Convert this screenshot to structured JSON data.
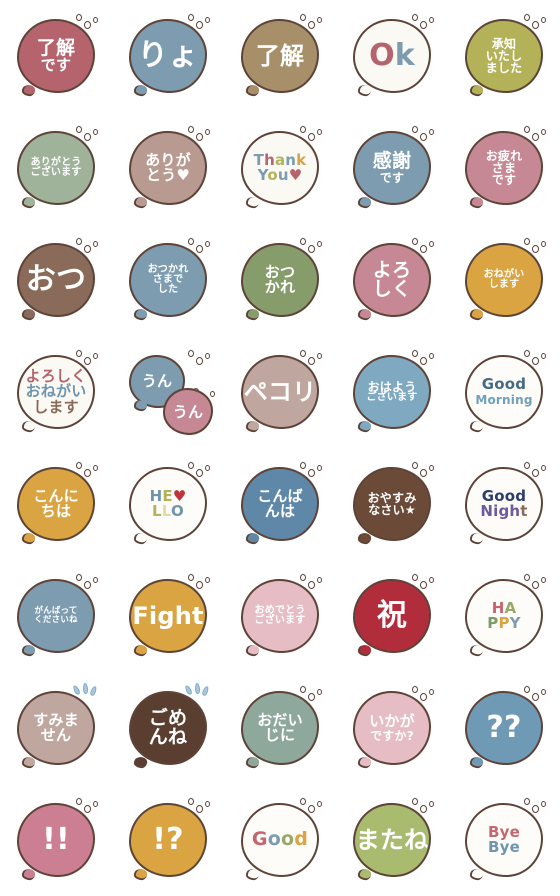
{
  "sheet": {
    "title": "Japanese Greeting Speech-Bubble Emoji Sheet",
    "background": "#ffffff",
    "columns": 5,
    "rows": 8,
    "outline_color": "#5d4338",
    "deco_bubble_color": "#ffffff",
    "sweat_drop_color": "#a8c9dd"
  },
  "stickers": [
    {
      "id": "r1c1",
      "name": "ryoukai-desu",
      "bubble_color": "#b5636c",
      "text_color": "#ffffff",
      "deco": "bubbles",
      "lines": [
        {
          "text": "了解",
          "size": "s-lg"
        },
        {
          "text": "です",
          "size": "s-md"
        }
      ]
    },
    {
      "id": "r1c2",
      "name": "ryo",
      "bubble_color": "#7d9cb0",
      "text_color": "#ffffff",
      "deco": "bubbles",
      "lines": [
        {
          "text": "りょ",
          "size": "s-xxl"
        }
      ]
    },
    {
      "id": "r1c3",
      "name": "ryoukai",
      "bubble_color": "#a78f6a",
      "text_color": "#ffffff",
      "deco": "bubbles",
      "lines": [
        {
          "text": "了解",
          "size": "s-xl"
        }
      ]
    },
    {
      "id": "r1c4",
      "name": "ok",
      "bubble_color": "#fbf9f4",
      "text_color": "#b5636c",
      "deco": "bubbles",
      "rich": [
        {
          "text": "O",
          "color": "#b5636c",
          "size": "s-xxl"
        },
        {
          "text": "k",
          "color": "#7d9cb0",
          "size": "s-xxl"
        }
      ]
    },
    {
      "id": "r1c5",
      "name": "shouchi-itashimashita",
      "bubble_color": "#b3b259",
      "text_color": "#ffffff",
      "deco": "bubbles",
      "lines": [
        {
          "text": "承知",
          "size": "s-sm"
        },
        {
          "text": "いたし",
          "size": "s-sm"
        },
        {
          "text": "ました",
          "size": "s-sm"
        }
      ]
    },
    {
      "id": "r2c1",
      "name": "arigatou-gozaimasu",
      "bubble_color": "#9fb39a",
      "text_color": "#ffffff",
      "deco": "bubbles",
      "lines": [
        {
          "text": "ありがとう",
          "size": "s-xs"
        },
        {
          "text": "ございます",
          "size": "s-xs"
        }
      ]
    },
    {
      "id": "r2c2",
      "name": "arigatou",
      "bubble_color": "#b99a90",
      "text_color": "#ffffff",
      "deco": "bubbles",
      "lines": [
        {
          "text": "ありが",
          "size": "s-md"
        },
        {
          "text": "とう♥",
          "size": "s-md"
        }
      ]
    },
    {
      "id": "r2c3",
      "name": "thank-you",
      "bubble_color": "#fbf9f4",
      "text_color": "#7d9cb0",
      "deco": "bubbles",
      "rich_lines": [
        [
          {
            "text": "T",
            "color": "#7d9cb0"
          },
          {
            "text": "h",
            "color": "#b5636c"
          },
          {
            "text": "a",
            "color": "#b3b259"
          },
          {
            "text": "n",
            "color": "#7d9cb0"
          },
          {
            "text": "k",
            "color": "#d9a441"
          }
        ],
        [
          {
            "text": "Y",
            "color": "#7d9cb0"
          },
          {
            "text": "o",
            "color": "#b3b259"
          },
          {
            "text": "u",
            "color": "#7d9cb0"
          },
          {
            "text": "♥",
            "color": "#b5636c"
          }
        ]
      ]
    },
    {
      "id": "r2c4",
      "name": "kansha-desu",
      "bubble_color": "#7d9cb0",
      "text_color": "#ffffff",
      "deco": "bubbles",
      "lines": [
        {
          "text": "感謝",
          "size": "s-lg"
        },
        {
          "text": "です",
          "size": "s-sm"
        }
      ]
    },
    {
      "id": "r2c5",
      "name": "otsukaresama-desu",
      "bubble_color": "#c68894",
      "text_color": "#ffffff",
      "deco": "bubbles",
      "lines": [
        {
          "text": "お疲れ",
          "size": "s-sm"
        },
        {
          "text": "さま",
          "size": "s-sm"
        },
        {
          "text": "です",
          "size": "s-sm"
        }
      ]
    },
    {
      "id": "r3c1",
      "name": "otsu",
      "bubble_color": "#8a6a58",
      "text_color": "#ffffff",
      "deco": "bubbles",
      "lines": [
        {
          "text": "おつ",
          "size": "s-xxl"
        }
      ]
    },
    {
      "id": "r3c2",
      "name": "otsukaresama-deshita",
      "bubble_color": "#7d9cb0",
      "text_color": "#ffffff",
      "deco": "bubbles",
      "lines": [
        {
          "text": "おつかれ",
          "size": "s-xs"
        },
        {
          "text": "さまで",
          "size": "s-xs"
        },
        {
          "text": "した",
          "size": "s-xs"
        }
      ]
    },
    {
      "id": "r3c3",
      "name": "otsukare",
      "bubble_color": "#879c6b",
      "text_color": "#ffffff",
      "deco": "bubbles",
      "lines": [
        {
          "text": "おつ",
          "size": "s-md"
        },
        {
          "text": "かれ",
          "size": "s-md"
        }
      ]
    },
    {
      "id": "r3c4",
      "name": "yoroshiku",
      "bubble_color": "#c68894",
      "text_color": "#ffffff",
      "deco": "bubbles",
      "lines": [
        {
          "text": "よろ",
          "size": "s-lg"
        },
        {
          "text": "しく",
          "size": "s-lg"
        }
      ]
    },
    {
      "id": "r3c5",
      "name": "onegai-shimasu",
      "bubble_color": "#d9a441",
      "text_color": "#ffffff",
      "deco": "bubbles",
      "lines": [
        {
          "text": "おねがい",
          "size": "s-xs"
        },
        {
          "text": "します",
          "size": "s-xs"
        }
      ]
    },
    {
      "id": "r4c1",
      "name": "yoroshiku-onegai-shimasu",
      "bubble_color": "#fbf9f4",
      "text_color": "#b5636c",
      "deco": "bubbles",
      "rich_lines": [
        [
          {
            "text": "よろしく",
            "color": "#b5636c"
          }
        ],
        [
          {
            "text": "おねがい",
            "color": "#6f95ae"
          }
        ],
        [
          {
            "text": "します",
            "color": "#8a6a58"
          }
        ]
      ]
    },
    {
      "id": "r4c2",
      "name": "un-un-double",
      "bubble_color": "#7d9cb0",
      "text_color": "#ffffff",
      "bubble2_color": "#c68894",
      "deco": "bubbles-double",
      "lines": [
        {
          "text": "うん",
          "size": "s-md"
        }
      ],
      "lines2": [
        {
          "text": "うん",
          "size": "s-md"
        }
      ]
    },
    {
      "id": "r4c3",
      "name": "pekori",
      "bubble_color": "#bfa69f",
      "text_color": "#ffffff",
      "deco": "bubbles",
      "lines": [
        {
          "text": "ペコリ",
          "size": "s-xl"
        }
      ]
    },
    {
      "id": "r4c4",
      "name": "ohayou-gozaimasu",
      "bubble_color": "#7ea9c0",
      "text_color": "#ffffff",
      "deco": "bubbles",
      "lines": [
        {
          "text": "おはよう",
          "size": "s-sm"
        },
        {
          "text": "ございます",
          "size": "s-xs"
        }
      ]
    },
    {
      "id": "r4c5",
      "name": "good-morning",
      "bubble_color": "#fdfcf8",
      "text_color": "#4a6d85",
      "deco": "bubbles",
      "rich_lines": [
        [
          {
            "text": "Good",
            "color": "#456b84",
            "size": "s-md"
          }
        ],
        [
          {
            "text": "Morning",
            "color": "#6fa0bd",
            "size": "s-sm"
          }
        ]
      ]
    },
    {
      "id": "r5c1",
      "name": "konnichiwa",
      "bubble_color": "#d9a441",
      "text_color": "#ffffff",
      "deco": "bubbles",
      "lines": [
        {
          "text": "こんに",
          "size": "s-md"
        },
        {
          "text": "ちは",
          "size": "s-md"
        }
      ]
    },
    {
      "id": "r5c2",
      "name": "hello",
      "bubble_color": "#fdfcf8",
      "text_color": "#7d9cb0",
      "deco": "bubbles",
      "rich_lines": [
        [
          {
            "text": "H",
            "color": "#6f95ae"
          },
          {
            "text": "E",
            "color": "#b3b259"
          },
          {
            "text": "♥",
            "color": "#c0343c"
          }
        ],
        [
          {
            "text": "L",
            "color": "#b3b259"
          },
          {
            "text": "L",
            "color": "#e3d9a8"
          },
          {
            "text": "O",
            "color": "#6f95ae"
          }
        ]
      ]
    },
    {
      "id": "r5c3",
      "name": "konbanwa",
      "bubble_color": "#5f87a8",
      "text_color": "#ffffff",
      "deco": "bubbles",
      "lines": [
        {
          "text": "こんば",
          "size": "s-md"
        },
        {
          "text": "んは",
          "size": "s-md"
        }
      ]
    },
    {
      "id": "r5c4",
      "name": "oyasumi-nasai",
      "bubble_color": "#6b4a38",
      "text_color": "#ffffff",
      "deco": "bubbles",
      "lines": [
        {
          "text": "おやすみ",
          "size": "s-sm"
        },
        {
          "text": "なさい★",
          "size": "s-sm"
        }
      ]
    },
    {
      "id": "r5c5",
      "name": "good-night",
      "bubble_color": "#fdfcf8",
      "text_color": "#2d3d6b",
      "deco": "bubbles",
      "rich_lines": [
        [
          {
            "text": "Good",
            "color": "#2d3d6b",
            "size": "s-md"
          }
        ],
        [
          {
            "text": "Nigh",
            "color": "#6b5a9e",
            "size": "s-md"
          },
          {
            "text": "t",
            "color": "#8a6a58",
            "size": "s-md"
          }
        ]
      ]
    },
    {
      "id": "r6c1",
      "name": "ganbatte-kudasai-ne",
      "bubble_color": "#7d9cb0",
      "text_color": "#ffffff",
      "deco": "bubbles",
      "lines": [
        {
          "text": "がんばって",
          "size": "s-xxs"
        },
        {
          "text": "くださいね",
          "size": "s-xxs"
        }
      ]
    },
    {
      "id": "r6c2",
      "name": "fight",
      "bubble_color": "#d9a441",
      "text_color": "#ffffff",
      "deco": "bubbles",
      "lines": [
        {
          "text": "Fight",
          "size": "s-xl"
        }
      ]
    },
    {
      "id": "r6c3",
      "name": "omedetou-gozaimasu",
      "bubble_color": "#e6bdc4",
      "text_color": "#ffffff",
      "deco": "bubbles",
      "lines": [
        {
          "text": "おめでとう",
          "size": "s-xs"
        },
        {
          "text": "ございます",
          "size": "s-xs"
        }
      ]
    },
    {
      "id": "r6c4",
      "name": "iwai",
      "bubble_color": "#b22d3c",
      "text_color": "#ffffff",
      "deco": "bubbles",
      "lines": [
        {
          "text": "祝",
          "size": "s-xxl"
        }
      ]
    },
    {
      "id": "r6c5",
      "name": "happy",
      "bubble_color": "#fdfcf8",
      "text_color": "#b5636c",
      "deco": "bubbles",
      "rich_lines": [
        [
          {
            "text": "H",
            "color": "#c4656f"
          },
          {
            "text": "A",
            "color": "#9aa76a"
          }
        ],
        [
          {
            "text": "P",
            "color": "#7d9a6a"
          },
          {
            "text": "P",
            "color": "#d9a441"
          },
          {
            "text": "Y",
            "color": "#7d9cb0"
          }
        ]
      ]
    },
    {
      "id": "r7c1",
      "name": "sumimasen",
      "bubble_color": "#bfa69f",
      "text_color": "#ffffff",
      "deco": "sweat",
      "lines": [
        {
          "text": "すみま",
          "size": "s-md"
        },
        {
          "text": "せん",
          "size": "s-md"
        }
      ]
    },
    {
      "id": "r7c2",
      "name": "gomen-ne",
      "bubble_color": "#5a3e30",
      "text_color": "#ffffff",
      "deco": "sweat",
      "lines": [
        {
          "text": "ごめ",
          "size": "s-lg"
        },
        {
          "text": "んね",
          "size": "s-lg"
        }
      ]
    },
    {
      "id": "r7c3",
      "name": "odaiji-ni",
      "bubble_color": "#8fa89c",
      "text_color": "#ffffff",
      "deco": "bubbles",
      "lines": [
        {
          "text": "おだい",
          "size": "s-md"
        },
        {
          "text": "じに",
          "size": "s-md"
        }
      ]
    },
    {
      "id": "r7c4",
      "name": "ikaga-desuka",
      "bubble_color": "#e6bdc4",
      "text_color": "#ffffff",
      "deco": "bubbles",
      "lines": [
        {
          "text": "いかが",
          "size": "s-md"
        },
        {
          "text": "ですか?",
          "size": "s-sm"
        }
      ]
    },
    {
      "id": "r7c5",
      "name": "double-question",
      "bubble_color": "#6f9ab5",
      "text_color": "#ffffff",
      "deco": "bubbles",
      "lines": [
        {
          "text": "??",
          "size": "s-xxl"
        }
      ]
    },
    {
      "id": "r8c1",
      "name": "double-exclamation",
      "bubble_color": "#cc7f92",
      "text_color": "#ffffff",
      "deco": "bubbles",
      "lines": [
        {
          "text": "!!",
          "size": "s-xxl"
        }
      ]
    },
    {
      "id": "r8c2",
      "name": "interrobang",
      "bubble_color": "#d9a441",
      "text_color": "#ffffff",
      "deco": "bubbles",
      "lines": [
        {
          "text": "!?",
          "size": "s-xxl"
        }
      ]
    },
    {
      "id": "r8c3",
      "name": "good",
      "bubble_color": "#fdfcf8",
      "text_color": "#b5636c",
      "deco": "bubbles",
      "rich": [
        {
          "text": "G",
          "color": "#c4656f",
          "size": "s-lg"
        },
        {
          "text": "o",
          "color": "#7d9cb0",
          "size": "s-lg"
        },
        {
          "text": "o",
          "color": "#9aa76a",
          "size": "s-lg"
        },
        {
          "text": "d",
          "color": "#d9a441",
          "size": "s-lg"
        }
      ]
    },
    {
      "id": "r8c4",
      "name": "matane",
      "bubble_color": "#a8bb6e",
      "text_color": "#ffffff",
      "deco": "bubbles",
      "lines": [
        {
          "text": "またね",
          "size": "s-xl"
        }
      ]
    },
    {
      "id": "r8c5",
      "name": "bye-bye",
      "bubble_color": "#fdfcf8",
      "text_color": "#b5636c",
      "deco": "bubbles",
      "rich_lines": [
        [
          {
            "text": "Bye",
            "color": "#c4656f",
            "size": "s-md"
          }
        ],
        [
          {
            "text": "Bye",
            "color": "#6f95ae",
            "size": "s-md"
          }
        ]
      ]
    }
  ]
}
